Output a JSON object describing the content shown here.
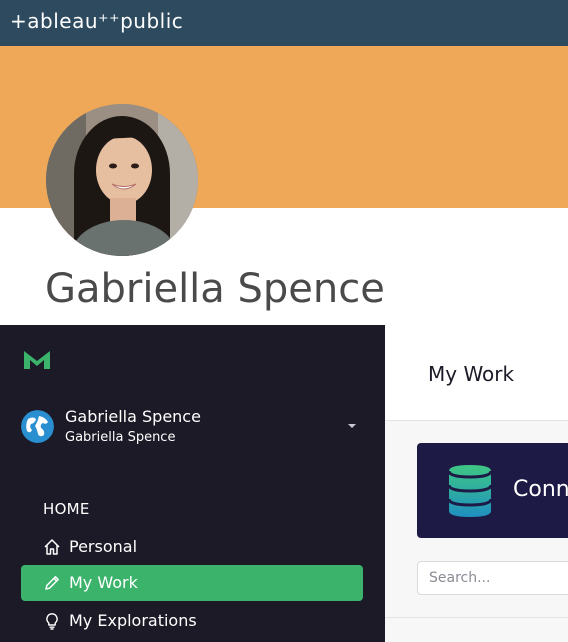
{
  "tableau": {
    "logo_text": "+ableau⁺⁺public",
    "profile_name": "Gabriella Spence",
    "banner_color": "#eea857",
    "topbar_color": "#2e4a5f"
  },
  "mode": {
    "logo_icon": "mode-m-logo-icon",
    "account": {
      "name": "Gabriella Spence",
      "workspace": "Gabriella Spence",
      "avatar_icon": "globe-icon"
    },
    "section_heading": "HOME",
    "nav": [
      {
        "label": "Personal",
        "icon": "home-icon",
        "active": false
      },
      {
        "label": "My Work",
        "icon": "pencil-icon",
        "active": true
      },
      {
        "label": "My Explorations",
        "icon": "lightbulb-icon",
        "active": false
      }
    ],
    "page_title": "My Work",
    "connect_label": "Conn",
    "search_placeholder": "Search...",
    "accent_color": "#3bb36b",
    "sidebar_color": "#1b1a26"
  }
}
